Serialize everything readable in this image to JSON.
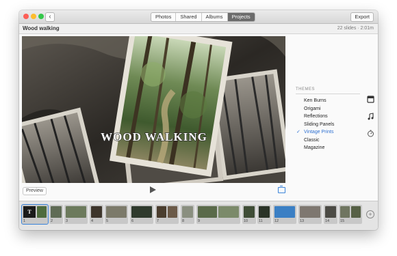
{
  "toolbar": {
    "back_label": "‹",
    "tabs": [
      {
        "label": "Photos",
        "active": false
      },
      {
        "label": "Shared",
        "active": false
      },
      {
        "label": "Albums",
        "active": false
      },
      {
        "label": "Projects",
        "active": true
      }
    ],
    "export_label": "Export",
    "traffic_lights": [
      "#fc5f57",
      "#fdbc2e",
      "#34c84a"
    ]
  },
  "project": {
    "title": "Wood walking",
    "info": "22 slides · 2:01m"
  },
  "viewer": {
    "slide_title": "WOOD WALKING",
    "preview_label": "Preview",
    "play_icon": "play-icon",
    "aspect_icon": "aspect-ratio-icon"
  },
  "themes": {
    "heading": "THEMES",
    "items": [
      {
        "label": "Ken Burns",
        "selected": false
      },
      {
        "label": "Origami",
        "selected": false
      },
      {
        "label": "Reflections",
        "selected": false
      },
      {
        "label": "Sliding Panels",
        "selected": false
      },
      {
        "label": "Vintage Prints",
        "selected": true
      },
      {
        "label": "Classic",
        "selected": false
      },
      {
        "label": "Magazine",
        "selected": false
      }
    ],
    "check_mark": "✓",
    "accent": "#2c6fd1"
  },
  "side_icons": [
    "theme-panel-icon",
    "music-note-icon",
    "duration-timer-icon"
  ],
  "timeline": {
    "title_thumb_letter": "T",
    "add_label": "+",
    "clips": [
      {
        "number": "1"
      },
      {
        "number": "2"
      },
      {
        "number": "3"
      },
      {
        "number": "4"
      },
      {
        "number": "5"
      },
      {
        "number": "6"
      },
      {
        "number": "7"
      },
      {
        "number": "8"
      },
      {
        "number": "9"
      },
      {
        "number": "10"
      },
      {
        "number": "11"
      },
      {
        "number": "12"
      },
      {
        "number": "13"
      },
      {
        "number": "14"
      },
      {
        "number": "15"
      }
    ]
  }
}
